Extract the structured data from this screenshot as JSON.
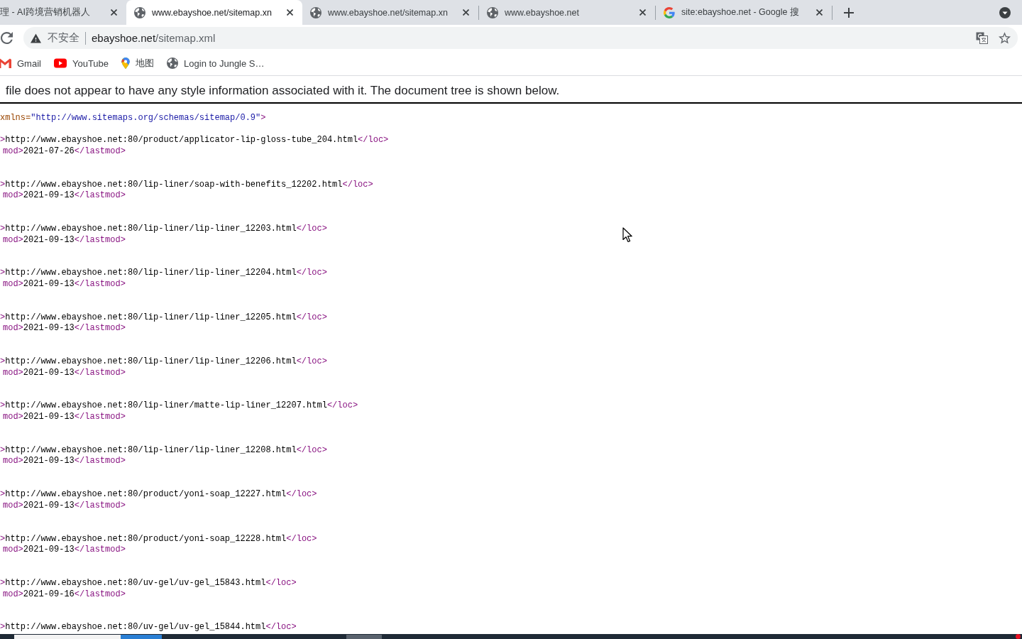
{
  "tabs": [
    {
      "kind": "clipped",
      "title": "理 - AI跨境营销机器人",
      "selected": false
    },
    {
      "kind": "page",
      "title": "www.ebayshoe.net/sitemap.xn",
      "selected": true
    },
    {
      "kind": "page",
      "title": "www.ebayshoe.net/sitemap.xn",
      "selected": false
    },
    {
      "kind": "page",
      "title": "www.ebayshoe.net",
      "selected": false
    },
    {
      "kind": "search",
      "title": "site:ebayshoe.net - Google 搜",
      "selected": false
    }
  ],
  "address_bar": {
    "security_label": "不安全",
    "host": "ebayshoe.net",
    "path": "/sitemap.xml"
  },
  "bookmarks": [
    {
      "kind": "gmail",
      "label": "Gmail"
    },
    {
      "kind": "youtube",
      "label": "YouTube"
    },
    {
      "kind": "maps",
      "label": "地图"
    },
    {
      "kind": "page",
      "label": "Login to Jungle S…"
    }
  ],
  "document": {
    "notice": "file does not appear to have any style information associated with it. The document tree is shown below.",
    "root_line": {
      "attr_name": "xmlns=",
      "attr_value": "\"http://www.sitemaps.org/schemas/sitemap/0.9\"",
      "close": ">"
    },
    "entries": [
      {
        "loc_open": ">",
        "loc": "http://www.ebayshoe.net:80/product/applicator-lip-gloss-tube_204.html",
        "loc_close": "</loc>",
        "lastmod_open": "mod>",
        "lastmod": "2021-07-26",
        "lastmod_close": "</lastmod>"
      },
      {
        "loc_open": ">",
        "loc": "http://www.ebayshoe.net:80/lip-liner/soap-with-benefits_12202.html",
        "loc_close": "</loc>",
        "lastmod_open": "mod>",
        "lastmod": "2021-09-13",
        "lastmod_close": "</lastmod>"
      },
      {
        "loc_open": ">",
        "loc": "http://www.ebayshoe.net:80/lip-liner/lip-liner_12203.html",
        "loc_close": "</loc>",
        "lastmod_open": "mod>",
        "lastmod": "2021-09-13",
        "lastmod_close": "</lastmod>"
      },
      {
        "loc_open": ">",
        "loc": "http://www.ebayshoe.net:80/lip-liner/lip-liner_12204.html",
        "loc_close": "</loc>",
        "lastmod_open": "mod>",
        "lastmod": "2021-09-13",
        "lastmod_close": "</lastmod>"
      },
      {
        "loc_open": ">",
        "loc": "http://www.ebayshoe.net:80/lip-liner/lip-liner_12205.html",
        "loc_close": "</loc>",
        "lastmod_open": "mod>",
        "lastmod": "2021-09-13",
        "lastmod_close": "</lastmod>"
      },
      {
        "loc_open": ">",
        "loc": "http://www.ebayshoe.net:80/lip-liner/lip-liner_12206.html",
        "loc_close": "</loc>",
        "lastmod_open": "mod>",
        "lastmod": "2021-09-13",
        "lastmod_close": "</lastmod>"
      },
      {
        "loc_open": ">",
        "loc": "http://www.ebayshoe.net:80/lip-liner/matte-lip-liner_12207.html",
        "loc_close": "</loc>",
        "lastmod_open": "mod>",
        "lastmod": "2021-09-13",
        "lastmod_close": "</lastmod>"
      },
      {
        "loc_open": ">",
        "loc": "http://www.ebayshoe.net:80/lip-liner/lip-liner_12208.html",
        "loc_close": "</loc>",
        "lastmod_open": "mod>",
        "lastmod": "2021-09-13",
        "lastmod_close": "</lastmod>"
      },
      {
        "loc_open": ">",
        "loc": "http://www.ebayshoe.net:80/product/yoni-soap_12227.html",
        "loc_close": "</loc>",
        "lastmod_open": "mod>",
        "lastmod": "2021-09-13",
        "lastmod_close": "</lastmod>"
      },
      {
        "loc_open": ">",
        "loc": "http://www.ebayshoe.net:80/product/yoni-soap_12228.html",
        "loc_close": "</loc>",
        "lastmod_open": "mod>",
        "lastmod": "2021-09-13",
        "lastmod_close": "</lastmod>"
      },
      {
        "loc_open": ">",
        "loc": "http://www.ebayshoe.net:80/uv-gel/uv-gel_15843.html",
        "loc_close": "</loc>",
        "lastmod_open": "mod>",
        "lastmod": "2021-09-16",
        "lastmod_close": "</lastmod>"
      },
      {
        "loc_open": ">",
        "loc": "http://www.ebayshoe.net:80/uv-gel/uv-gel_15844.html",
        "loc_close": "</loc>"
      }
    ]
  }
}
